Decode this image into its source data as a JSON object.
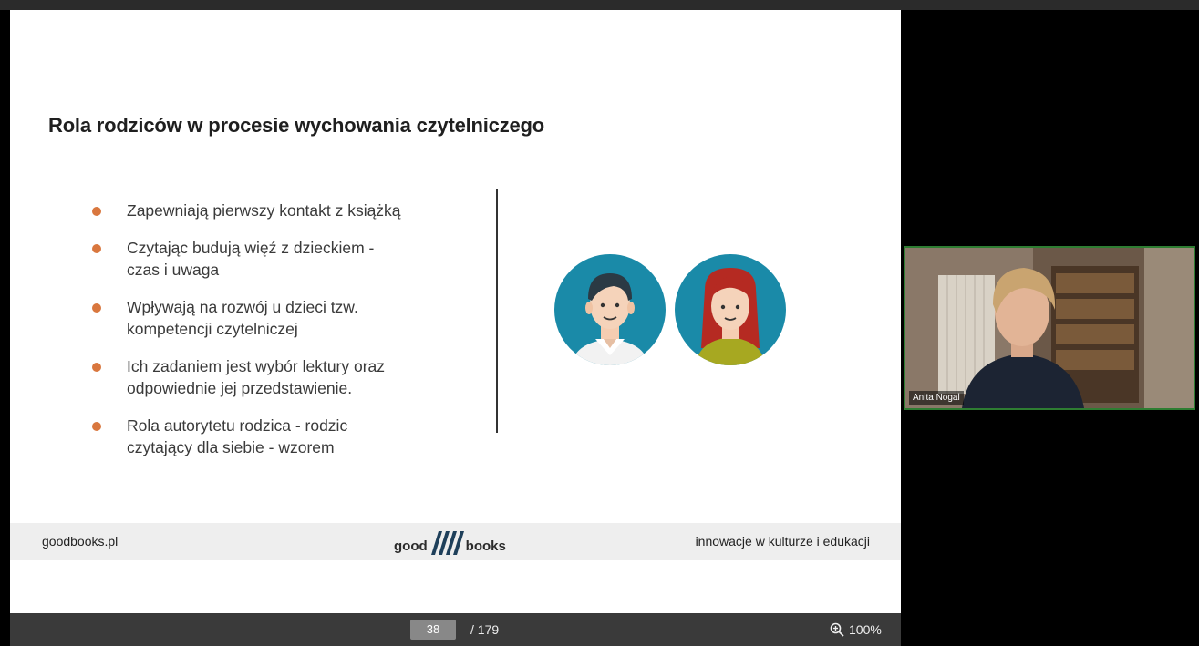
{
  "slide": {
    "title": "Rola rodziców w procesie wychowania czytelniczego",
    "bullets": [
      {
        "lines": [
          "Zapewniają pierwszy kontakt z książką"
        ]
      },
      {
        "lines": [
          "Czytając budują więź z dzieckiem -",
          "czas i uwaga"
        ]
      },
      {
        "lines": [
          "Wpływają na rozwój u dzieci tzw.",
          "kompetencji czytelniczej"
        ]
      },
      {
        "lines": [
          "Ich zadaniem jest wybór lektury oraz",
          "odpowiednie jej przedstawienie."
        ]
      },
      {
        "lines": [
          "Rola autorytetu rodzica - rodzic",
          "czytający dla siebie - wzorem"
        ]
      }
    ],
    "bullet_color": "#d9773e",
    "avatar_circle_color": "#1a8aa8",
    "footer": {
      "left": "goodbooks.pl",
      "logo_left": "good",
      "logo_right": "books",
      "right": "innowacje w kulturze i edukacji"
    }
  },
  "viewer": {
    "current_page": "38",
    "total_pages": "/ 179",
    "zoom": "100%"
  },
  "participant": {
    "name": "Anita Nogal",
    "border_color": "#2e7d32"
  }
}
